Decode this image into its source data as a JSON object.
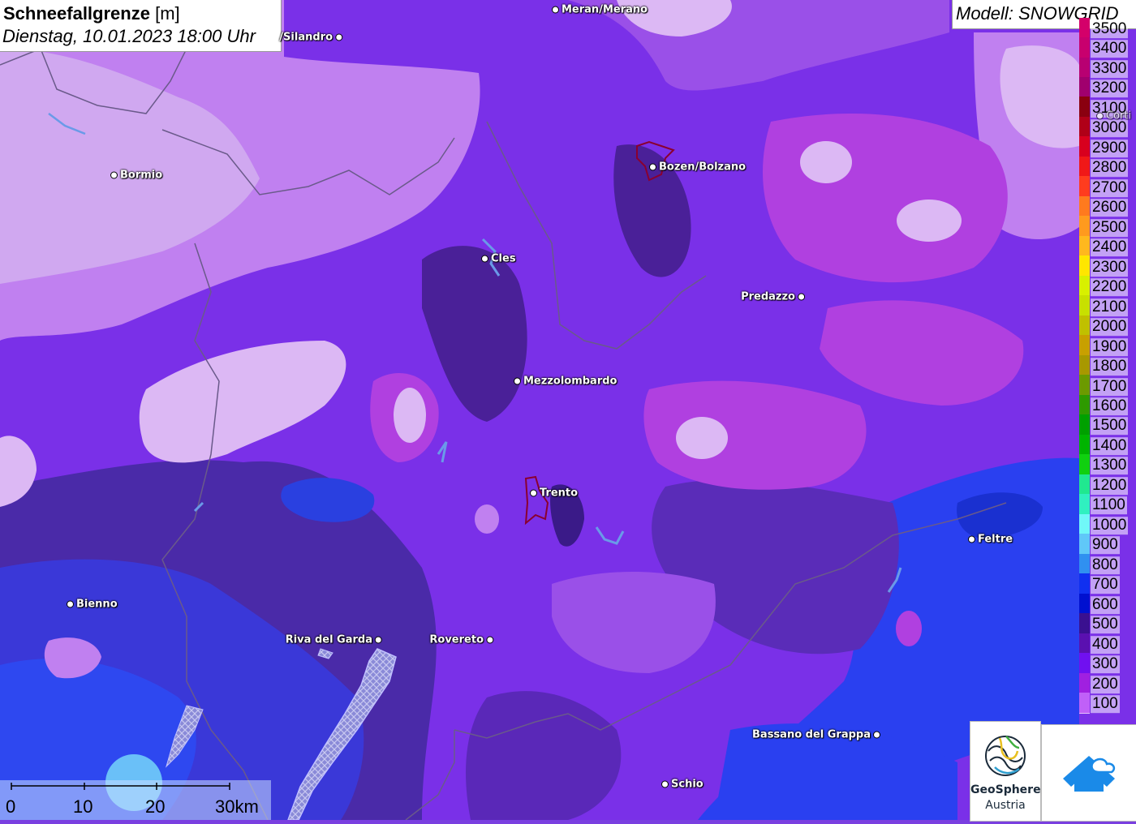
{
  "title": {
    "main": "Schneefallgrenze",
    "unit": "[m]",
    "datetime": "Dienstag, 10.01.2023 18:00 Uhr"
  },
  "model": "Modell: SNOWGRID",
  "legend": [
    {
      "label": "3500",
      "color": "#d4006a"
    },
    {
      "label": "3400",
      "color": "#c8006e"
    },
    {
      "label": "3300",
      "color": "#b80072"
    },
    {
      "label": "3200",
      "color": "#a0006e"
    },
    {
      "label": "3100",
      "color": "#8a0010"
    },
    {
      "label": "3000",
      "color": "#b00018"
    },
    {
      "label": "2900",
      "color": "#d8001e"
    },
    {
      "label": "2800",
      "color": "#f01818"
    },
    {
      "label": "2700",
      "color": "#ff3c1e"
    },
    {
      "label": "2600",
      "color": "#ff7a1e"
    },
    {
      "label": "2500",
      "color": "#ff9a1e"
    },
    {
      "label": "2400",
      "color": "#ffb81e"
    },
    {
      "label": "2300",
      "color": "#ffe600"
    },
    {
      "label": "2200",
      "color": "#d8f000"
    },
    {
      "label": "2100",
      "color": "#c8e000"
    },
    {
      "label": "2000",
      "color": "#c0c000"
    },
    {
      "label": "1900",
      "color": "#c8a000"
    },
    {
      "label": "1800",
      "color": "#a89800"
    },
    {
      "label": "1700",
      "color": "#6c9a00"
    },
    {
      "label": "1600",
      "color": "#2e9a00"
    },
    {
      "label": "1500",
      "color": "#00a000"
    },
    {
      "label": "1400",
      "color": "#00b400"
    },
    {
      "label": "1300",
      "color": "#10d010"
    },
    {
      "label": "1200",
      "color": "#20e890"
    },
    {
      "label": "1100",
      "color": "#30f0c0"
    },
    {
      "label": "1000",
      "color": "#70f8f8"
    },
    {
      "label": "900",
      "color": "#60c8f8"
    },
    {
      "label": "800",
      "color": "#3090f0"
    },
    {
      "label": "700",
      "color": "#1030f0"
    },
    {
      "label": "600",
      "color": "#0010d0"
    },
    {
      "label": "500",
      "color": "#3a1090"
    },
    {
      "label": "400",
      "color": "#5a10b0"
    },
    {
      "label": "300",
      "color": "#7010f0"
    },
    {
      "label": "200",
      "color": "#a020e0"
    },
    {
      "label": "100",
      "color": "#c060f8"
    }
  ],
  "cities": [
    {
      "name": "Meran/Merano"
    },
    {
      "name": "/Silandro"
    },
    {
      "name": "Bormio"
    },
    {
      "name": "Bozen/Bolzano"
    },
    {
      "name": "Cles"
    },
    {
      "name": "Predazzo"
    },
    {
      "name": "Mezzolombardo"
    },
    {
      "name": "Trento"
    },
    {
      "name": "Feltre"
    },
    {
      "name": "Bienno"
    },
    {
      "name": "Riva del Garda"
    },
    {
      "name": "Rovereto"
    },
    {
      "name": "Bassano del Grappa"
    },
    {
      "name": "Schio"
    },
    {
      "name": "Corti"
    }
  ],
  "scale": {
    "labels": [
      "0",
      "10",
      "20",
      "30km"
    ]
  },
  "logos": {
    "geosphere_line1": "GeoSphere",
    "geosphere_line2": "Austria"
  }
}
